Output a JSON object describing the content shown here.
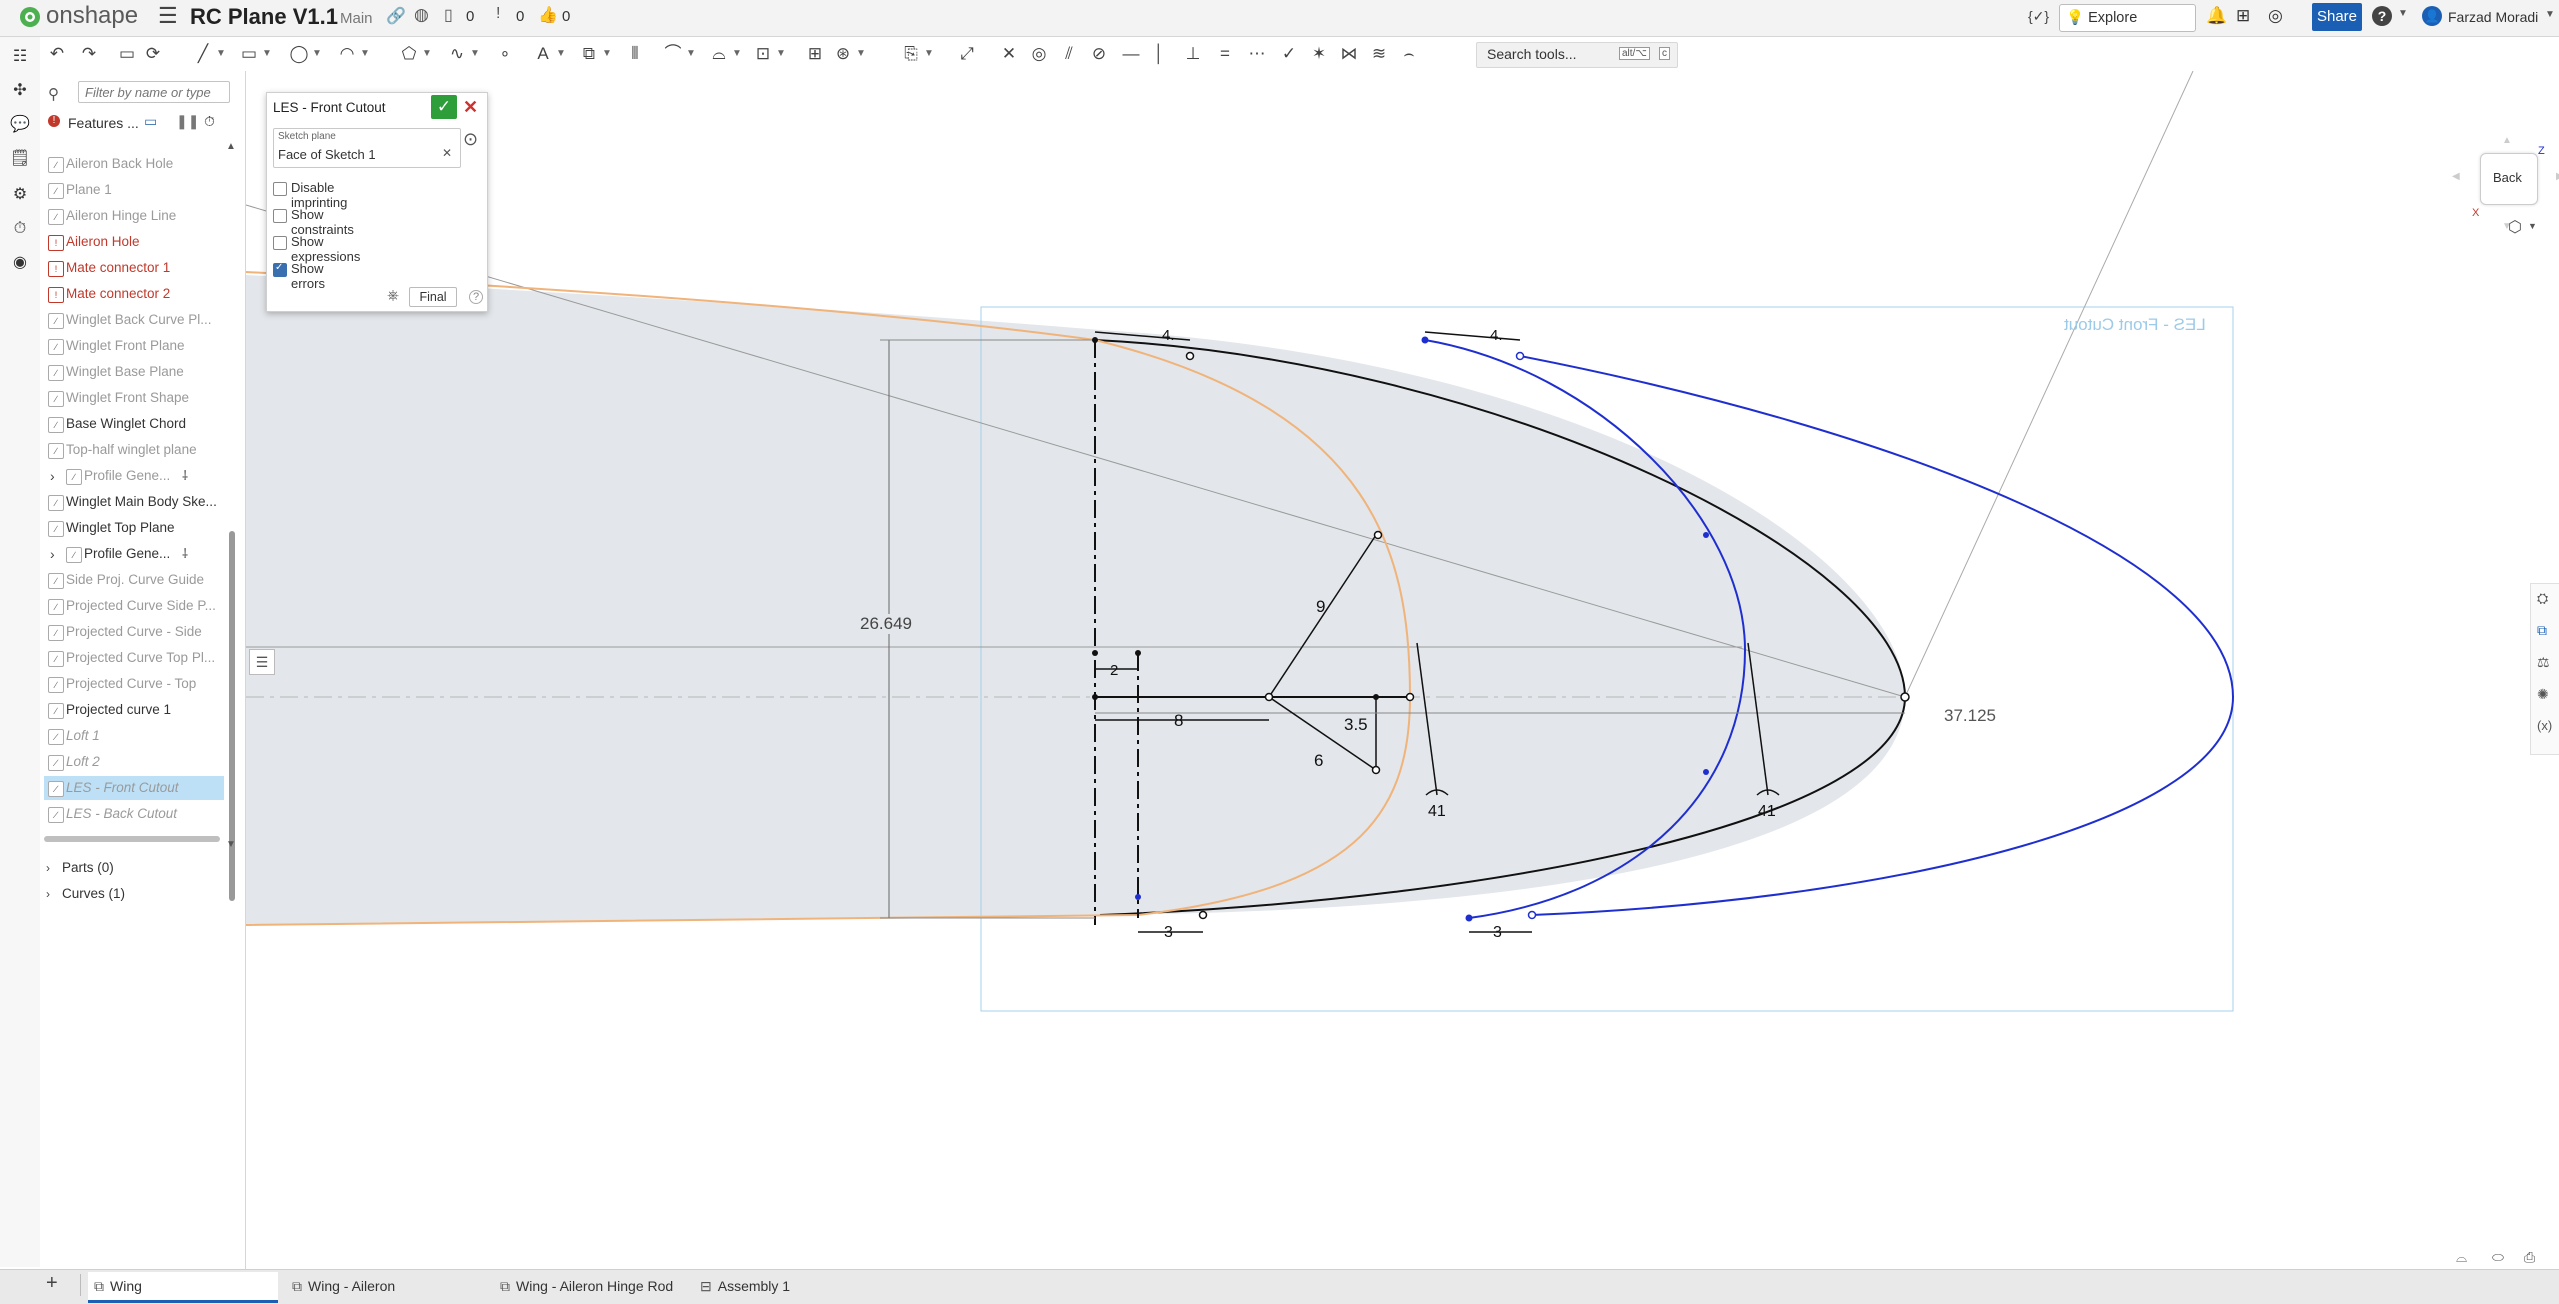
{
  "app": {
    "brand": "onshape",
    "doc_title": "RC Plane V1.1",
    "branch": "Main",
    "count_a": "0",
    "count_b": "0",
    "count_c": "0"
  },
  "header": {
    "explore_label": "Explore Onshape",
    "share_label": "Share",
    "help_label": "?",
    "user_name": "Farzad Moradi",
    "code_icon": "{✓}"
  },
  "toolbar": {
    "search_label": "Search tools...",
    "shortcut_key": "alt/⌥",
    "shortcut_key2": "c"
  },
  "panel": {
    "filter_placeholder": "Filter by name or type",
    "features_label": "Features ...",
    "items": [
      {
        "label": "Aileron Back Hole",
        "style": "dim"
      },
      {
        "label": "Plane 1",
        "style": "dim"
      },
      {
        "label": "Aileron Hinge Line",
        "style": "dim"
      },
      {
        "label": "Aileron Hole",
        "style": "err"
      },
      {
        "label": "Mate connector 1",
        "style": "err"
      },
      {
        "label": "Mate connector 2",
        "style": "err"
      },
      {
        "label": "Winglet Back Curve Pl...",
        "style": "dim"
      },
      {
        "label": "Winglet Front Plane",
        "style": "dim"
      },
      {
        "label": "Winglet Base Plane",
        "style": "dim"
      },
      {
        "label": "Winglet Front Shape",
        "style": "dim"
      },
      {
        "label": "Base Winglet Chord",
        "style": "normal"
      },
      {
        "label": "Top-half winglet plane",
        "style": "dim"
      },
      {
        "label": "Profile Gene...",
        "style": "dim"
      },
      {
        "label": "Winglet Main Body Ske...",
        "style": "normal"
      },
      {
        "label": "Winglet Top Plane",
        "style": "normal"
      },
      {
        "label": "Profile Gene...",
        "style": "normal"
      },
      {
        "label": "Side Proj. Curve Guide",
        "style": "dim"
      },
      {
        "label": "Projected Curve Side P...",
        "style": "dim"
      },
      {
        "label": "Projected Curve - Side",
        "style": "dim"
      },
      {
        "label": "Projected Curve Top Pl...",
        "style": "dim"
      },
      {
        "label": "Projected Curve - Top",
        "style": "dim"
      },
      {
        "label": "Projected curve 1",
        "style": "normal"
      },
      {
        "label": "Loft 1",
        "style": "strike"
      },
      {
        "label": "Loft 2",
        "style": "strike"
      },
      {
        "label": "LES - Front Cutout",
        "style": "sel"
      },
      {
        "label": "LES - Back Cutout",
        "style": "italic"
      }
    ],
    "parts_label": "Parts (0)",
    "curves_label": "Curves (1)"
  },
  "dialog": {
    "title": "LES - Front Cutout",
    "sketch_plane_label": "Sketch plane",
    "sketch_plane_value": "Face of Sketch 1",
    "options": [
      {
        "label": "Disable imprinting",
        "checked": false
      },
      {
        "label": "Show constraints",
        "checked": false
      },
      {
        "label": "Show expressions",
        "checked": false
      },
      {
        "label": "Show errors",
        "checked": true
      }
    ],
    "final_label": "Final"
  },
  "canvas": {
    "sketch_label": "LES - Front Cutout",
    "dims": {
      "left_width_1": "4.",
      "right_width_1": "4.",
      "height": "26.649",
      "d9": "9",
      "d2": "2",
      "d8": "8",
      "d35": "3.5",
      "d6": "6",
      "angle_1": "41",
      "angle_2": "41",
      "length": "37.125",
      "bottom_1": "3",
      "bottom_2": "3"
    },
    "view_cube": {
      "face": "Back",
      "axis_z": "Z",
      "axis_x": "X"
    }
  },
  "tabs": [
    {
      "label": "Wing",
      "active": true
    },
    {
      "label": "Wing - Aileron",
      "active": false
    },
    {
      "label": "Wing - Aileron Hinge Rod",
      "active": false
    },
    {
      "label": "Assembly 1",
      "active": false
    }
  ],
  "colors": {
    "accent": "#1a5fb4",
    "sketch_black": "#111111",
    "sketch_orange": "#f0b37a",
    "sketch_blue": "#1f2fcf",
    "face_fill": "#e3e6ea",
    "error_red": "#c0392b"
  }
}
